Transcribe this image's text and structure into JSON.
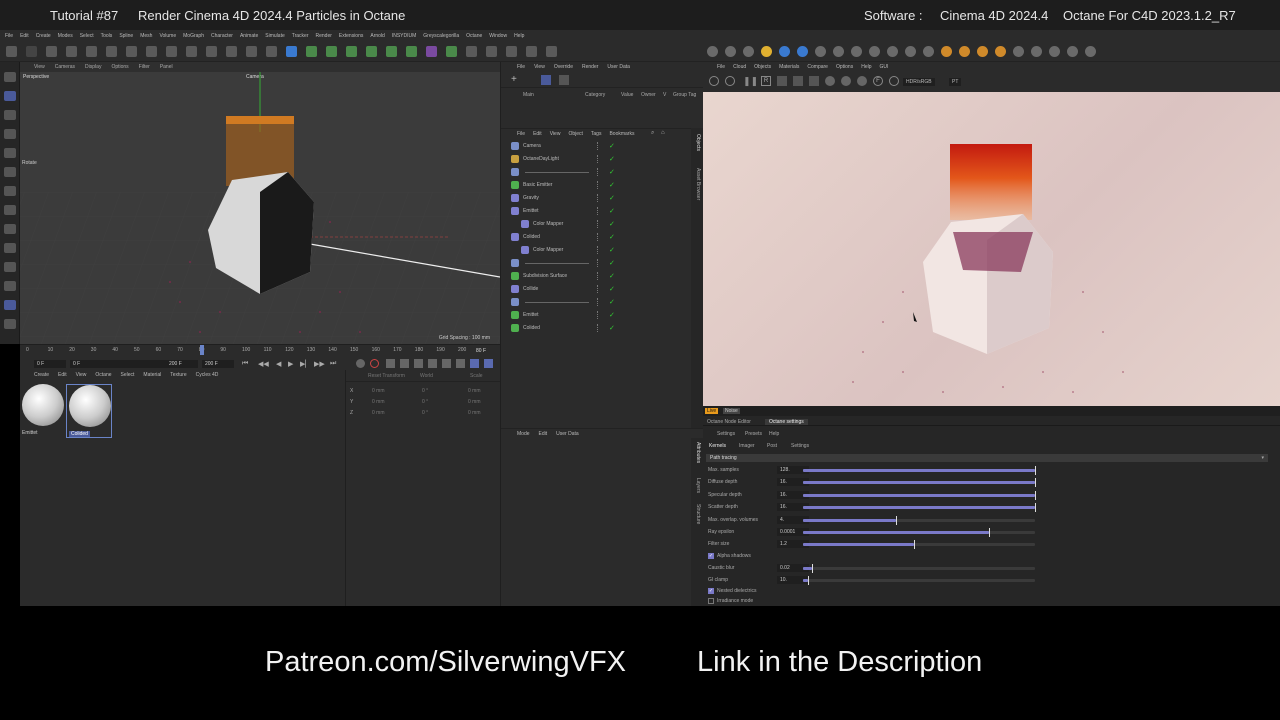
{
  "header": {
    "tutorial": "Tutorial #87",
    "title": "Render Cinema 4D 2024.4 Particles in Octane",
    "software_label": "Software :",
    "software": "Cinema 4D 2024.4",
    "plugin": "Octane For C4D 2023.1.2_R7"
  },
  "menubar": [
    "File",
    "Edit",
    "Create",
    "Modes",
    "Select",
    "Tools",
    "Spline",
    "Mesh",
    "Volume",
    "MoGraph",
    "Character",
    "Animate",
    "Simulate",
    "Tracker",
    "Render",
    "Extensions",
    "Arnold",
    "INSYDIUM",
    "Greyscalegorilla",
    "Octane",
    "Window",
    "Help"
  ],
  "viewport": {
    "menu": [
      "View",
      "Cameras",
      "Display",
      "Options",
      "Filter",
      "Panel"
    ],
    "name": "Perspective",
    "camera": "Camera",
    "tool": "Rotate",
    "grid_spacing": "Grid Spacing : 100 mm"
  },
  "timeline": {
    "ticks": [
      "0",
      "10",
      "20",
      "30",
      "40",
      "50",
      "60",
      "70",
      "80",
      "90",
      "100",
      "110",
      "120",
      "130",
      "140",
      "150",
      "160",
      "170",
      "180",
      "190",
      "200"
    ],
    "end_marker": "80 F",
    "field1": "0 F",
    "field2": "0 F",
    "field3": "200 F",
    "field4": "200 F"
  },
  "material_manager": {
    "menu": [
      "Create",
      "Edit",
      "View",
      "Octane",
      "Select",
      "Material",
      "Texture",
      "Cycles 4D"
    ],
    "materials": [
      {
        "name": "Emittet",
        "selected": false
      },
      {
        "name": "Colided",
        "selected": true
      }
    ]
  },
  "coordinates": {
    "header": [
      "Reset Transform",
      "World",
      "Scale"
    ],
    "rows": [
      {
        "axis": "X",
        "pos": "0 mm",
        "rot": "0 °",
        "size": "0 mm"
      },
      {
        "axis": "Y",
        "pos": "0 mm",
        "rot": "0 °",
        "size": "0 mm"
      },
      {
        "axis": "Z",
        "pos": "0 mm",
        "rot": "0 °",
        "size": "0 mm"
      }
    ]
  },
  "layer_panel": {
    "menu": [
      "File",
      "View",
      "Override",
      "Render",
      "User Data"
    ],
    "tabs": [
      "Main"
    ],
    "columns": [
      "Category",
      "Value",
      "Owner",
      "V",
      "Group Tag"
    ]
  },
  "object_manager": {
    "menu": [
      "File",
      "Edit",
      "View",
      "Object",
      "Tags",
      "Bookmarks"
    ],
    "side_tabs": [
      "Objects",
      "Asset Browser"
    ],
    "objects": [
      {
        "name": "Camera",
        "color": "#7a8fc8"
      },
      {
        "name": "OctaneDayLight",
        "color": "#c8a040"
      },
      {
        "name": "",
        "color": "#7a8fc8"
      },
      {
        "name": "Basic Emitter",
        "color": "#4fb04f"
      },
      {
        "name": "Gravity",
        "color": "#8080d0"
      },
      {
        "name": "Emittet",
        "color": "#8080d0"
      },
      {
        "name": "Color Mapper",
        "color": "#8080d0"
      },
      {
        "name": "Colided",
        "color": "#8080d0"
      },
      {
        "name": "Color Mapper",
        "color": "#8080d0"
      },
      {
        "name": "",
        "color": "#7a8fc8"
      },
      {
        "name": "Subdivision Surface",
        "color": "#4fb04f"
      },
      {
        "name": "Collide",
        "color": "#8080d0"
      },
      {
        "name": "",
        "color": "#7a8fc8"
      },
      {
        "name": "Emittet",
        "color": "#4fb04f"
      },
      {
        "name": "Colided",
        "color": "#4fb04f"
      }
    ]
  },
  "attributes": {
    "menu": [
      "Mode",
      "Edit",
      "User Data"
    ],
    "side_tabs": [
      "Attributes",
      "Layers",
      "Structure"
    ]
  },
  "octane_viewer": {
    "menu": [
      "File",
      "Cloud",
      "Objects",
      "Materials",
      "Compare",
      "Options",
      "Help",
      "GUI"
    ],
    "color_space": "HDR/sRGB",
    "preset": "PT",
    "status_tabs": [
      "Live",
      "Noise"
    ]
  },
  "octane_settings": {
    "window_tabs": [
      "Octane Node Editor",
      "Octane settings"
    ],
    "tabs": [
      "Settings",
      "Presets",
      "Help"
    ],
    "subtabs": [
      "Kernels",
      "Imager",
      "Post",
      "Settings"
    ],
    "kernel": "Path tracing",
    "params": [
      {
        "label": "Max. samples",
        "value": "128.",
        "fill": 1.0
      },
      {
        "label": "Diffuse depth",
        "value": "16.",
        "fill": 1.0
      },
      {
        "label": "Specular depth",
        "value": "16.",
        "fill": 1.0
      },
      {
        "label": "Scatter depth",
        "value": "16.",
        "fill": 1.0
      },
      {
        "label": "Max. overlap. volumes",
        "value": "4.",
        "fill": 0.4
      },
      {
        "label": "Ray epsilon",
        "value": "0.0001",
        "fill": 0.8
      },
      {
        "label": "Filter size",
        "value": "1.2",
        "fill": 0.48
      }
    ],
    "alpha_shadows": "Alpha shadows",
    "params2": [
      {
        "label": "Caustic blur",
        "value": "0.02",
        "fill": 0.04
      },
      {
        "label": "GI clamp",
        "value": "10.",
        "fill": 0.02
      }
    ],
    "checks": [
      {
        "label": "Nested dielectrics",
        "checked": true
      },
      {
        "label": "Irradiance mode",
        "checked": false
      }
    ]
  },
  "footer": {
    "patreon": "Patreon.com/SilverwingVFX",
    "link": "Link in the Description"
  },
  "colors": {
    "accent": "#7a79c8",
    "panel": "#2b2b2b",
    "check": "#33cc33",
    "live": "#e89a1c"
  }
}
